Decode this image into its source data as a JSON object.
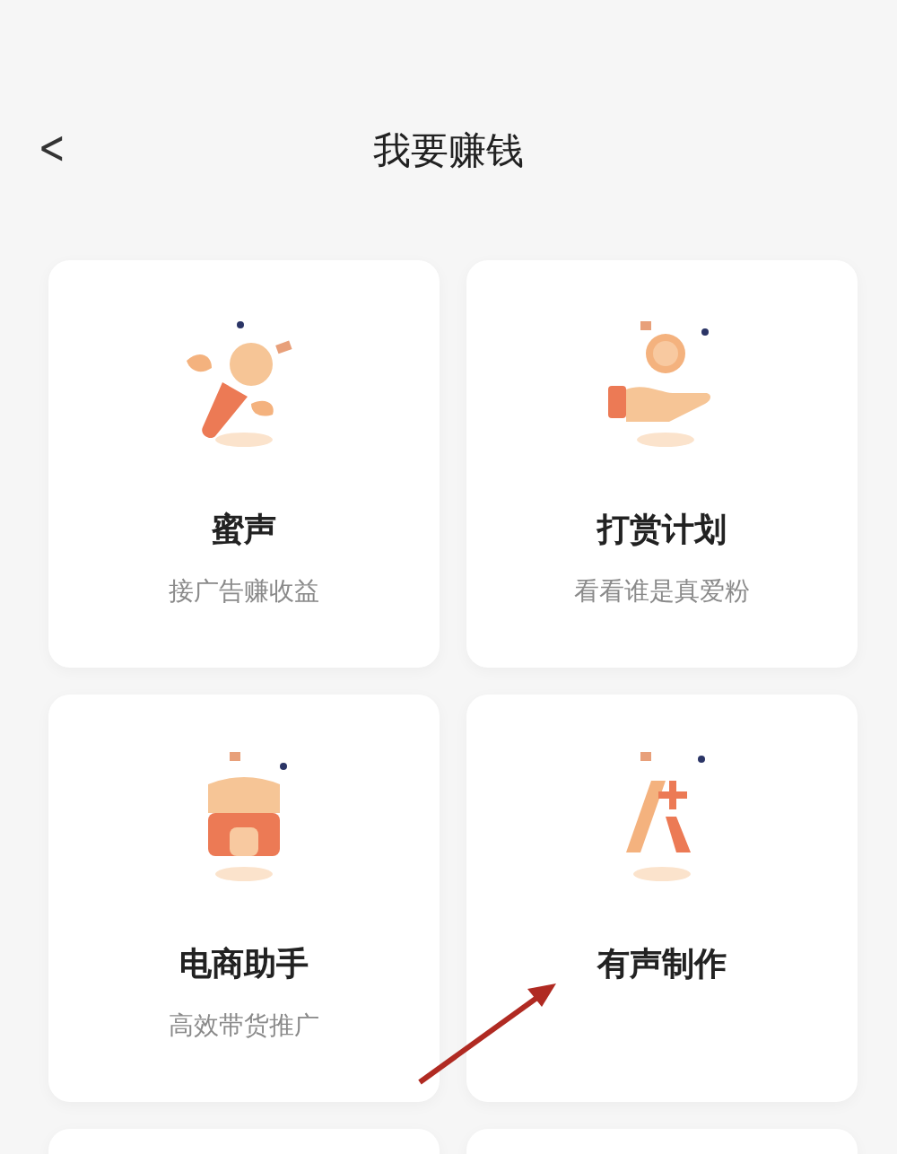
{
  "header": {
    "back": "<",
    "title": "我要赚钱"
  },
  "cards": [
    {
      "kind": "mic",
      "title": "蜜声",
      "subtitle": "接广告赚收益"
    },
    {
      "kind": "coin-hand",
      "title": "打赏计划",
      "subtitle": "看看谁是真爱粉"
    },
    {
      "kind": "shop",
      "title": "电商助手",
      "subtitle": "高效带货推广"
    },
    {
      "kind": "spark-a",
      "title": "有声制作"
    },
    {
      "kind": "blank"
    },
    {
      "kind": "blank"
    }
  ]
}
